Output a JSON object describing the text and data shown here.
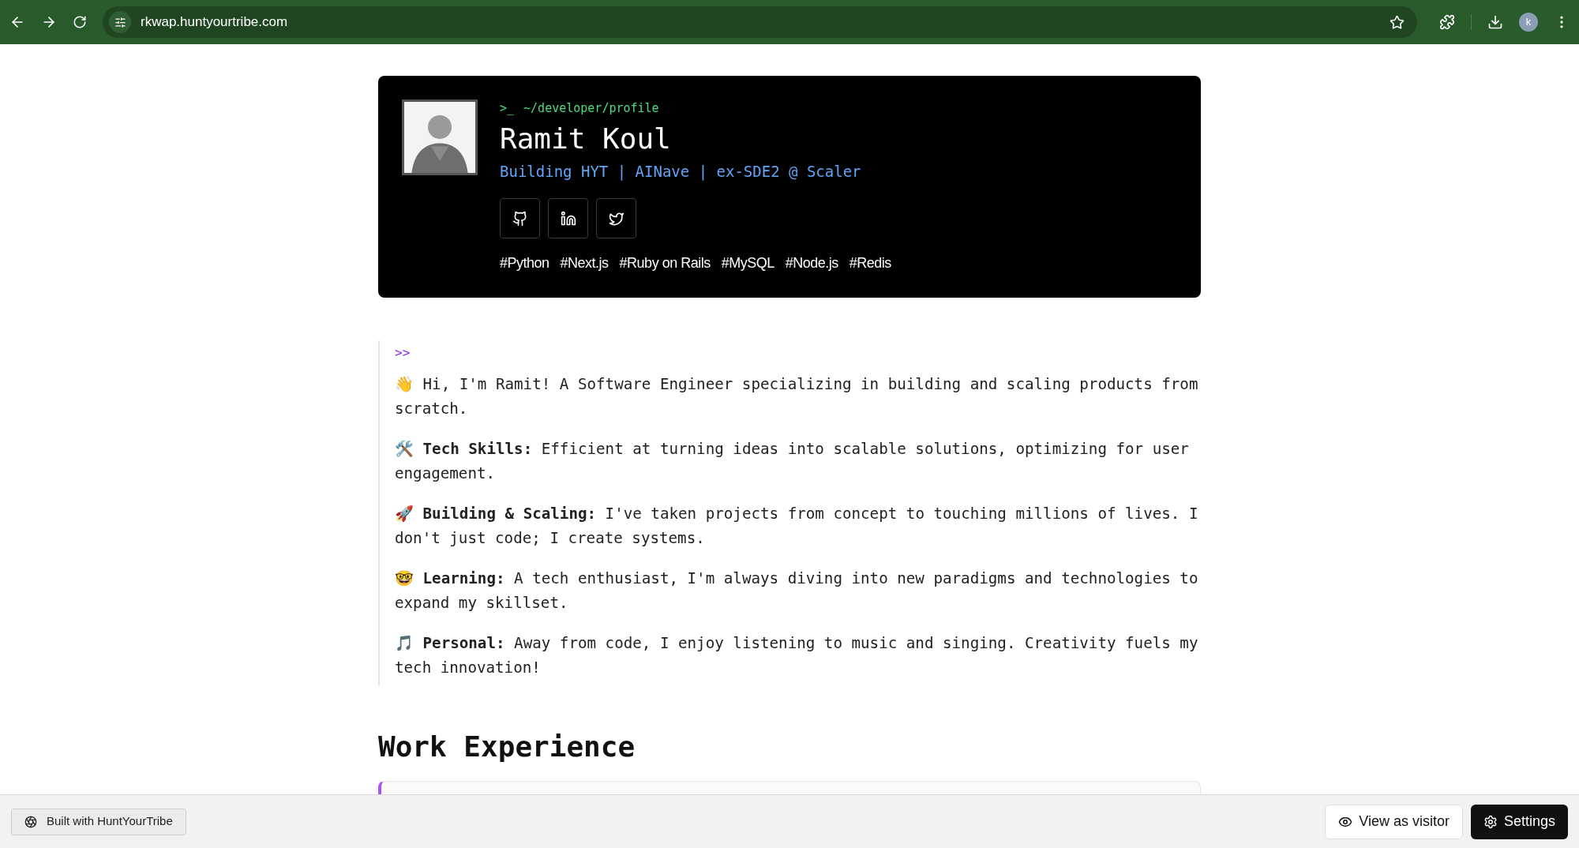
{
  "browser": {
    "url": "rkwap.huntyourtribe.com",
    "profile_initial": "k"
  },
  "profile": {
    "path_prompt": ">_",
    "path": "~/developer/profile",
    "name": "Ramit Koul",
    "headline": "Building HYT | AINave | ex-SDE2 @ Scaler",
    "socials": [
      {
        "kind": "github"
      },
      {
        "kind": "linkedin"
      },
      {
        "kind": "twitter"
      }
    ],
    "tags": [
      "#Python",
      "#Next.js",
      "#Ruby on Rails",
      "#MySQL",
      "#Node.js",
      "#Redis"
    ]
  },
  "about": {
    "prompt": ">>",
    "paragraphs": [
      "👋 Hi, I'm Ramit! A Software Engineer specializing in building and scaling products from scratch.",
      "🛠️ **Tech Skills:** Efficient at turning ideas into scalable solutions, optimizing for user engagement.",
      "🚀 **Building & Scaling:** I've taken projects from concept to touching millions of lives. I don't just code; I create systems.",
      "🤓 **Learning:** A tech enthusiast, I'm always diving into new paradigms and technologies to expand my skillset.",
      "🎵 **Personal:** Away from code, I enjoy listening to music and singing. Creativity fuels my tech innovation!"
    ]
  },
  "work_experience": {
    "title": "Work Experience"
  },
  "footer": {
    "badge": "Built with HuntYourTribe",
    "buttons": [
      {
        "kind": "outline",
        "label": "View as visitor"
      },
      {
        "kind": "solid",
        "label": "Settings"
      }
    ]
  }
}
